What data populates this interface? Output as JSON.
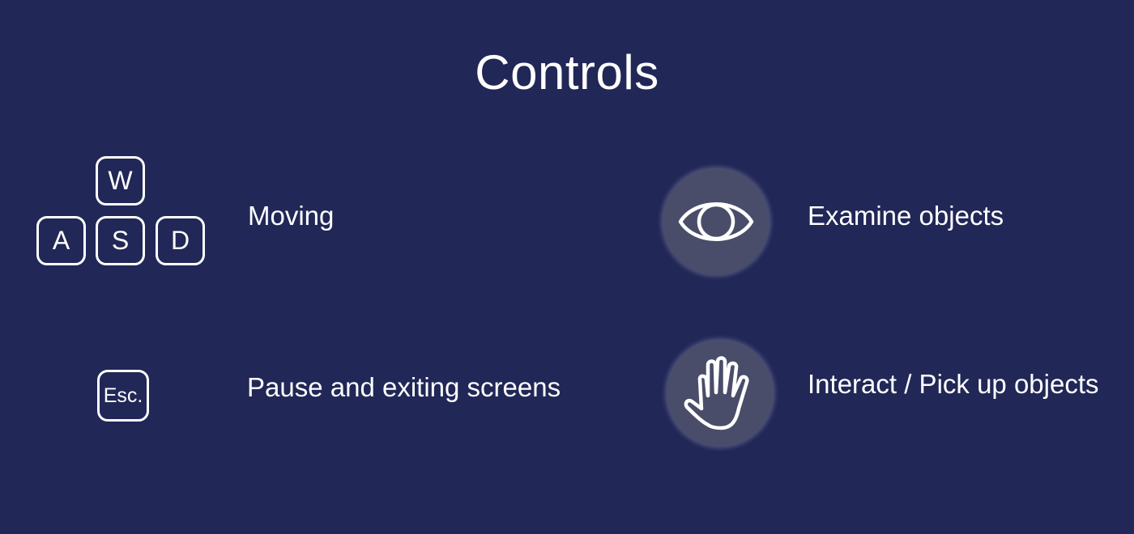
{
  "title": "Controls",
  "controls": {
    "moving": {
      "keys": [
        "W",
        "A",
        "S",
        "D"
      ],
      "label": "Moving"
    },
    "pause": {
      "key": "Esc.",
      "label": "Pause and exiting screens"
    },
    "examine": {
      "icon": "eye-icon",
      "label": "Examine objects"
    },
    "interact": {
      "icon": "hand-icon",
      "label": "Interact / Pick up objects"
    }
  },
  "colors": {
    "background": "#212756",
    "icon_circle": "#4a4d69",
    "foreground": "#ffffff"
  }
}
